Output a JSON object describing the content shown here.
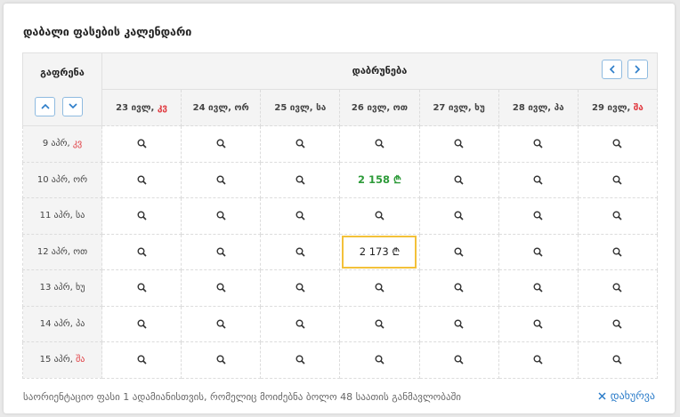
{
  "title": "დაბალი ფასების კალენდარი",
  "departure_header": "გაფრენა",
  "return_header": "დაბრუნება",
  "return_dates": [
    {
      "label": "23 ივლ,",
      "day": "კვ",
      "weekend": true
    },
    {
      "label": "24 ივლ,",
      "day": "ორ",
      "weekend": false
    },
    {
      "label": "25 ივლ,",
      "day": "სა",
      "weekend": false
    },
    {
      "label": "26 ივლ,",
      "day": "ოთ",
      "weekend": false
    },
    {
      "label": "27 ივლ,",
      "day": "ხუ",
      "weekend": false
    },
    {
      "label": "28 ივლ,",
      "day": "პა",
      "weekend": false
    },
    {
      "label": "29 ივლ,",
      "day": "შა",
      "weekend": true
    }
  ],
  "departure_dates": [
    {
      "label": "9 აპრ,",
      "day": "კვ",
      "weekend": true
    },
    {
      "label": "10 აპრ,",
      "day": "ორ",
      "weekend": false
    },
    {
      "label": "11 აპრ,",
      "day": "სა",
      "weekend": false
    },
    {
      "label": "12 აპრ,",
      "day": "ოთ",
      "weekend": false
    },
    {
      "label": "13 აპრ,",
      "day": "ხუ",
      "weekend": false
    },
    {
      "label": "14 აპრ,",
      "day": "პა",
      "weekend": false
    },
    {
      "label": "15 აპრ,",
      "day": "შა",
      "weekend": true
    }
  ],
  "prices": [
    {
      "row": 1,
      "col": 3,
      "value": "2 158 ₾",
      "style": "lowest"
    },
    {
      "row": 3,
      "col": 3,
      "value": "2 173 ₾",
      "style": "selected"
    }
  ],
  "footer_note": "საორიენტაციო ფასი 1 ადამიანისთვის, რომელიც მოიძებნა ბოლო 48 საათის განმავლობაში",
  "close_label": "დახურვა",
  "colors": {
    "accent": "#2b7cc9",
    "weekend": "#e0383e",
    "lowest_price": "#2e9b3a",
    "selected_border": "#f3c13a"
  }
}
